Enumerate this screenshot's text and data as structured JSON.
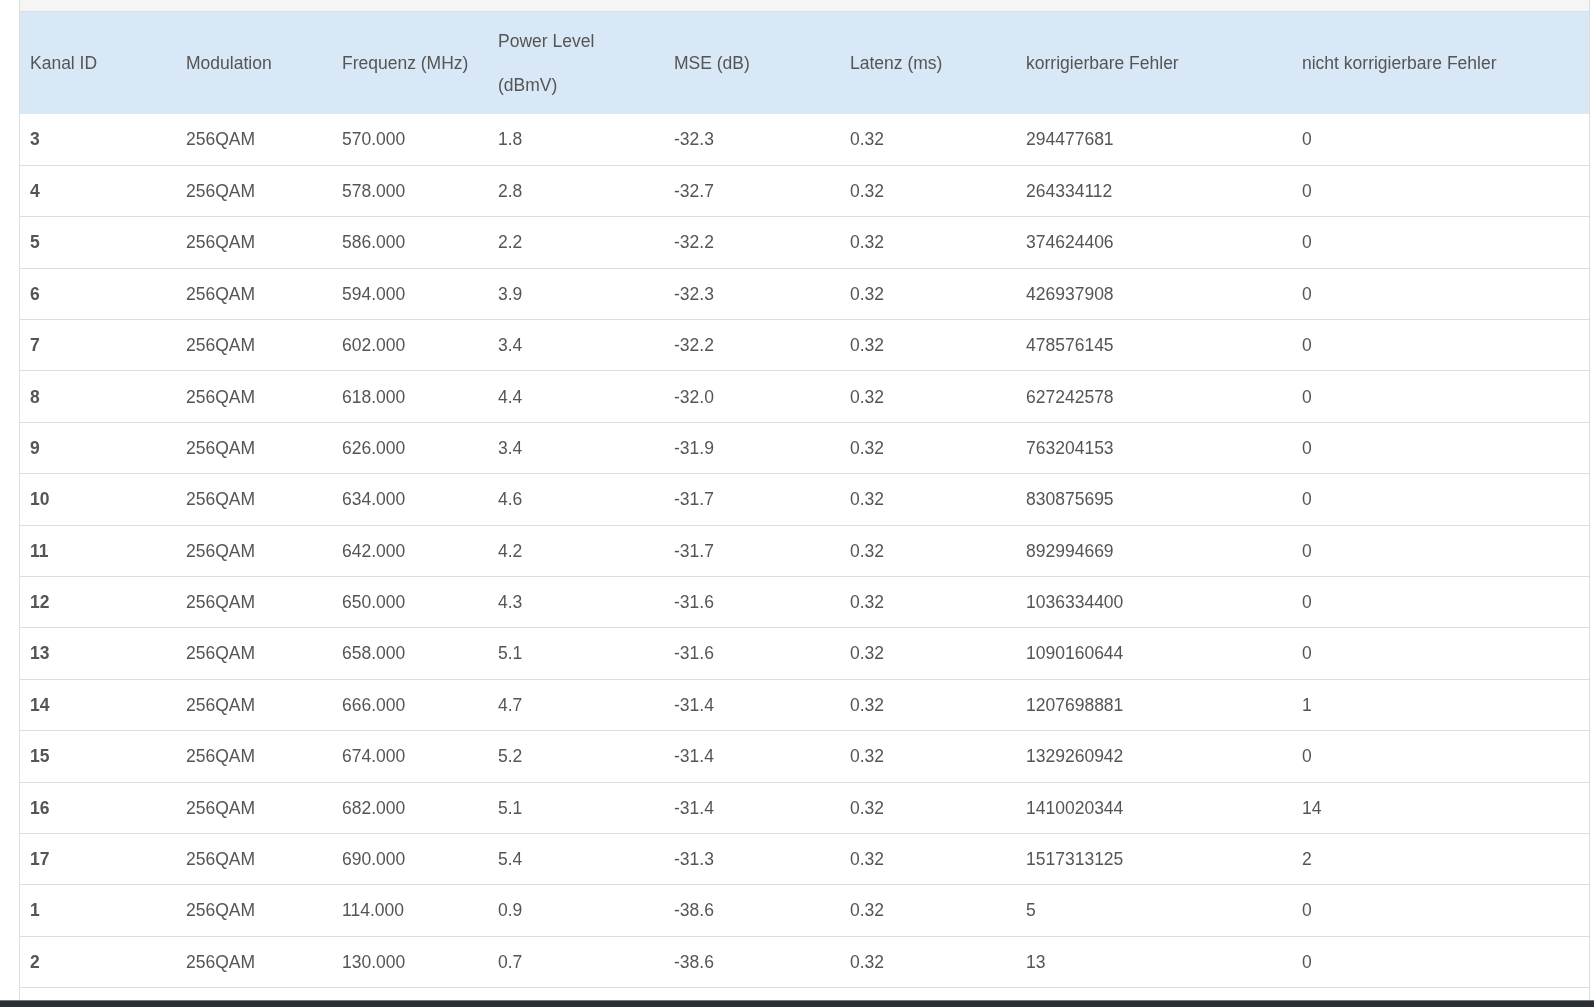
{
  "table": {
    "columns": [
      "Kanal ID",
      "Modulation",
      "Frequenz (MHz)",
      "Power Level (dBmV)",
      "MSE (dB)",
      "Latenz (ms)",
      "korrigierbare Fehler",
      "nicht korrigierbare Fehler"
    ],
    "rows": [
      [
        "3",
        "256QAM",
        "570.000",
        "1.8",
        "-32.3",
        "0.32",
        "294477681",
        "0"
      ],
      [
        "4",
        "256QAM",
        "578.000",
        "2.8",
        "-32.7",
        "0.32",
        "264334112",
        "0"
      ],
      [
        "5",
        "256QAM",
        "586.000",
        "2.2",
        "-32.2",
        "0.32",
        "374624406",
        "0"
      ],
      [
        "6",
        "256QAM",
        "594.000",
        "3.9",
        "-32.3",
        "0.32",
        "426937908",
        "0"
      ],
      [
        "7",
        "256QAM",
        "602.000",
        "3.4",
        "-32.2",
        "0.32",
        "478576145",
        "0"
      ],
      [
        "8",
        "256QAM",
        "618.000",
        "4.4",
        "-32.0",
        "0.32",
        "627242578",
        "0"
      ],
      [
        "9",
        "256QAM",
        "626.000",
        "3.4",
        "-31.9",
        "0.32",
        "763204153",
        "0"
      ],
      [
        "10",
        "256QAM",
        "634.000",
        "4.6",
        "-31.7",
        "0.32",
        "830875695",
        "0"
      ],
      [
        "11",
        "256QAM",
        "642.000",
        "4.2",
        "-31.7",
        "0.32",
        "892994669",
        "0"
      ],
      [
        "12",
        "256QAM",
        "650.000",
        "4.3",
        "-31.6",
        "0.32",
        "1036334400",
        "0"
      ],
      [
        "13",
        "256QAM",
        "658.000",
        "5.1",
        "-31.6",
        "0.32",
        "1090160644",
        "0"
      ],
      [
        "14",
        "256QAM",
        "666.000",
        "4.7",
        "-31.4",
        "0.32",
        "1207698881",
        "1"
      ],
      [
        "15",
        "256QAM",
        "674.000",
        "5.2",
        "-31.4",
        "0.32",
        "1329260942",
        "0"
      ],
      [
        "16",
        "256QAM",
        "682.000",
        "5.1",
        "-31.4",
        "0.32",
        "1410020344",
        "14"
      ],
      [
        "17",
        "256QAM",
        "690.000",
        "5.4",
        "-31.3",
        "0.32",
        "1517313125",
        "2"
      ],
      [
        "1",
        "256QAM",
        "114.000",
        "0.9",
        "-38.6",
        "0.32",
        "5",
        "0"
      ],
      [
        "2",
        "256QAM",
        "130.000",
        "0.7",
        "-38.6",
        "0.32",
        "13",
        "0"
      ]
    ]
  }
}
